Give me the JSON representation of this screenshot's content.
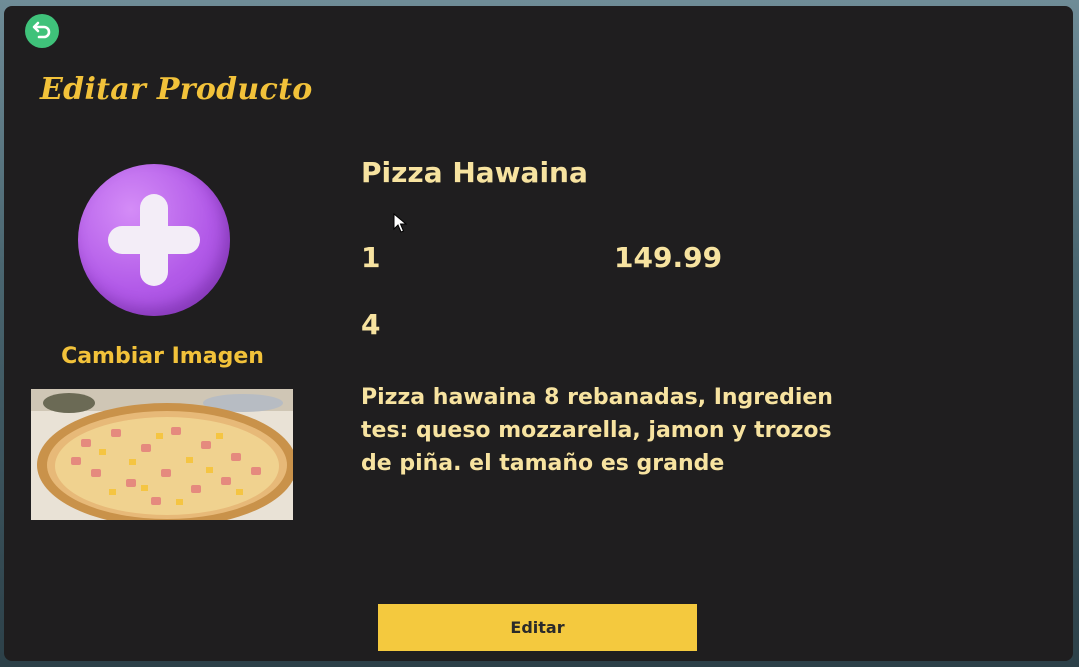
{
  "page": {
    "title": "Editar Producto"
  },
  "image_panel": {
    "change_image_label": "Cambiar Imagen"
  },
  "product": {
    "name": "Pizza Hawaina",
    "quantity": "1",
    "price": "149.99",
    "category": "4",
    "description": "Pizza hawaina 8 rebanadas, Ingredien\ntes: queso mozzarella,  jamon y trozos\nde piña. el tamaño es grande"
  },
  "actions": {
    "edit_label": "Editar"
  },
  "icons": {
    "back": "back-arrow-icon",
    "add": "plus-icon"
  },
  "colors": {
    "accent": "#f2c23a",
    "field_text": "#f7e3a0",
    "background": "#1f1e1f",
    "back_button": "#3fc27a",
    "add_button": "#b25ae8",
    "edit_button": "#f4c93e"
  }
}
